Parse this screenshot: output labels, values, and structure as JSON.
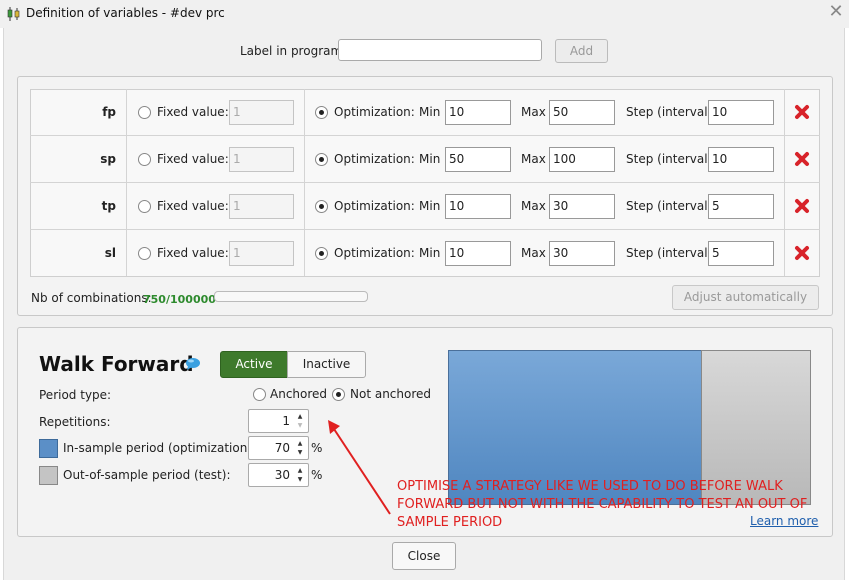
{
  "window": {
    "title": "Definition of variables - #dev prc"
  },
  "label_row": {
    "label": "Label in program",
    "input_value": "",
    "add_label": "Add"
  },
  "variables": {
    "fixed_label": "Fixed value:",
    "optimization_label": "Optimization:",
    "min_label": "Min",
    "max_label": "Max",
    "step_label": "Step (interval)",
    "rows": [
      {
        "name": "fp",
        "fixed": "1",
        "min": "10",
        "max": "50",
        "step": "10"
      },
      {
        "name": "sp",
        "fixed": "1",
        "min": "50",
        "max": "100",
        "step": "10"
      },
      {
        "name": "tp",
        "fixed": "1",
        "min": "10",
        "max": "30",
        "step": "5"
      },
      {
        "name": "sl",
        "fixed": "1",
        "min": "10",
        "max": "30",
        "step": "5"
      }
    ],
    "nb_label": "Nb of combinations:",
    "nb_value": "750/100000",
    "adjust_label": "Adjust automatically"
  },
  "walk_forward": {
    "title": "Walk Forward",
    "active_label": "Active",
    "inactive_label": "Inactive",
    "active_state": "Active",
    "period_type_label": "Period type:",
    "anchored_label": "Anchored",
    "not_anchored_label": "Not anchored",
    "period_type_selected": "Not anchored",
    "repetitions_label": "Repetitions:",
    "repetitions_value": "1",
    "in_sample_label": "In-sample period (optimization)",
    "in_sample_value": "70",
    "out_sample_label": "Out-of-sample period (test):",
    "out_sample_value": "30",
    "percent": "%",
    "learn_more": "Learn more",
    "in_sample_fraction": 0.7,
    "colors": {
      "in_sample": "#5b8fc7",
      "out_sample": "#c4c4c4",
      "active": "#3e7a2c"
    }
  },
  "annotation": {
    "text": "OPTIMISE A STRATEGY LIKE WE USED TO DO BEFORE WALK FORWARD BUT NOT WITH THE CAPABILITY TO TEST AN OUT OF SAMPLE PERIOD",
    "color": "#e02020"
  },
  "footer": {
    "close_label": "Close"
  }
}
